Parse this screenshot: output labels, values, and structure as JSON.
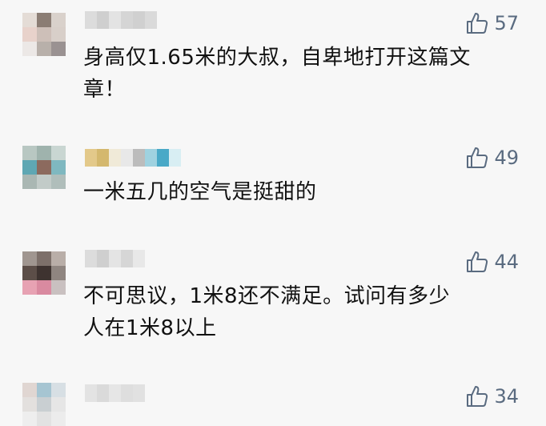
{
  "comments": [
    {
      "likes": "57",
      "text_lines": [
        "身高仅1.65米的大叔，自卑地打开这篇文",
        "章！"
      ],
      "avatar_colors": [
        "#e4dcd6",
        "#8b7d74",
        "#d9d1cb",
        "#e8d2cb",
        "#cdbfb8",
        "#d8cfc9",
        "#ece8e6",
        "#b8b0aa",
        "#9a9292"
      ],
      "name_colors": [
        "#dcdcdc",
        "#cfcfcf",
        "#e3e3e3",
        "#d5d5d5",
        "#d0d0d0",
        "#dadada"
      ]
    },
    {
      "likes": "49",
      "text_lines": [
        "一米五几的空气是挺甜的"
      ],
      "avatar_colors": [
        "#b8c7c2",
        "#9fb3ad",
        "#c9d6d2",
        "#5fa7b3",
        "#8c6a5e",
        "#7fb8c0",
        "#aab7b3",
        "#c2cbc8",
        "#b0bebb"
      ],
      "name_colors": [
        "#e3c98a",
        "#d4b86e",
        "#f0ead8",
        "#e8e8e8",
        "#bcbcbc",
        "#9fd2e0",
        "#49a9c7",
        "#d8eef3"
      ]
    },
    {
      "likes": "44",
      "text_lines": [
        "不可思议，1米8还不满足。试问有多少",
        "人在1米8以上"
      ],
      "avatar_colors": [
        "#a09690",
        "#7d706a",
        "#b9aea8",
        "#5c4e48",
        "#3e3330",
        "#8f8580",
        "#e7a2b3",
        "#d98aa0",
        "#c9c0c0"
      ],
      "name_colors": [
        "#dcdcdc",
        "#cfcfcf",
        "#e4e4e4",
        "#d6d6d6",
        "#e8e8e8"
      ]
    },
    {
      "likes": "34",
      "text_lines": [],
      "avatar_colors": [
        "#e0d6d2",
        "#a6c5d2",
        "#d7dfe4",
        "#e3e0de",
        "#c9cfd2",
        "#e6e6e6",
        "#eeeeee",
        "#e2e2e2",
        "#ececec"
      ],
      "name_colors": [
        "#e3e3e3",
        "#dadada",
        "#e6e6e6",
        "#dedede",
        "#e1e1e1"
      ]
    }
  ],
  "colors": {
    "background": "#f7f7f7",
    "text": "#111111",
    "like": "#5a6b80"
  },
  "icons": {
    "like": "thumbs-up-outline-icon"
  }
}
